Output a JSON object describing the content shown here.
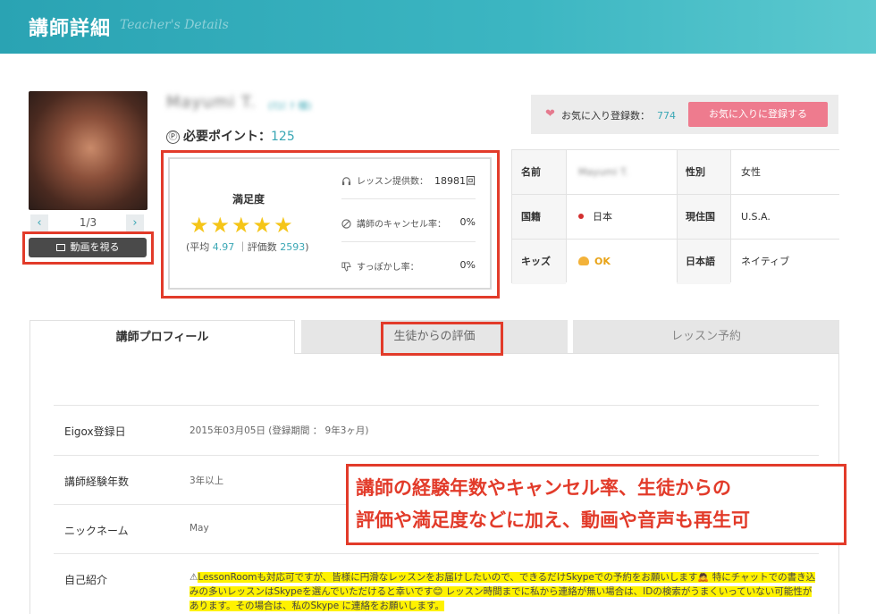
{
  "header": {
    "title": "講師詳細",
    "subtitle": "Teacher's Details"
  },
  "photo": {
    "counter": "1/3",
    "prev": "‹",
    "next": "›",
    "video_button": "動画を視る"
  },
  "teacher": {
    "name": "Mayumi T.",
    "name_sub": "(ﾏﾕﾐ ﾃ 様)"
  },
  "points": {
    "icon": "Ⓟ",
    "label": "必要ポイント：",
    "value": "125"
  },
  "satisfaction": {
    "title": "満足度",
    "stars": "★★★★★",
    "rating": 5,
    "avg_label": "(平均",
    "avg_value": "4.97",
    "sep": "｜評価数",
    "count": "2593",
    "close": ")"
  },
  "stats": [
    {
      "label": "レッスン提供数：",
      "value": "18981回",
      "icon": "headphones-icon"
    },
    {
      "label": "講師のキャンセル率：",
      "value": "0%",
      "icon": "cancel-icon"
    },
    {
      "label": "すっぽかし率：",
      "value": "0%",
      "icon": "thumbs-down-icon"
    }
  ],
  "favorite": {
    "label": "お気に入り登録数：",
    "count": "774",
    "button": "お気に入りに登録する"
  },
  "info": {
    "name_key": "名前",
    "name_val": "Mayumi T.",
    "gender_key": "性別",
    "gender_val": "女性",
    "nationality_key": "国籍",
    "nationality_val": "日本",
    "residence_key": "現住国",
    "residence_val": "U.S.A.",
    "kids_key": "キッズ",
    "kids_val": "OK",
    "japanese_key": "日本語",
    "japanese_val": "ネイティブ"
  },
  "tabs": [
    "講師プロフィール",
    "生徒からの評価",
    "レッスン予約"
  ],
  "profile": {
    "reg_key": "Eigox登録日",
    "reg_val": "2015年03月05日 (登録期間 ： 9年3ヶ月)",
    "exp_key": "講師経験年数",
    "exp_val": "3年以上",
    "nick_key": "ニックネーム",
    "nick_val": "May",
    "intro_key": "自己紹介",
    "intro_prefix": "⚠",
    "intro_hl1": "LessonRoomも対応可ですが、皆様に円滑なレッスンをお届けしたいので、できるだけSkypeでの予約をお願いします🙇 特にチャットでの書き込みの多いレッスンはSkypeを選んでいただけると幸いです😊 レッスン時間までに私から連絡が無い場合は、IDの検索がうまくいっていない可能性があります。その場合は、私のSkype に連絡をお願いします。"
  },
  "callout": {
    "line1": "講師の経験年数やキャンセル率、生徒からの",
    "line2": "評価や満足度などに加え、動画や音声も再生可"
  },
  "colors": {
    "accent": "#3aa7b5",
    "highlight_red": "#e23b2a",
    "star": "#f5c518",
    "pink": "#ee7b8e"
  }
}
